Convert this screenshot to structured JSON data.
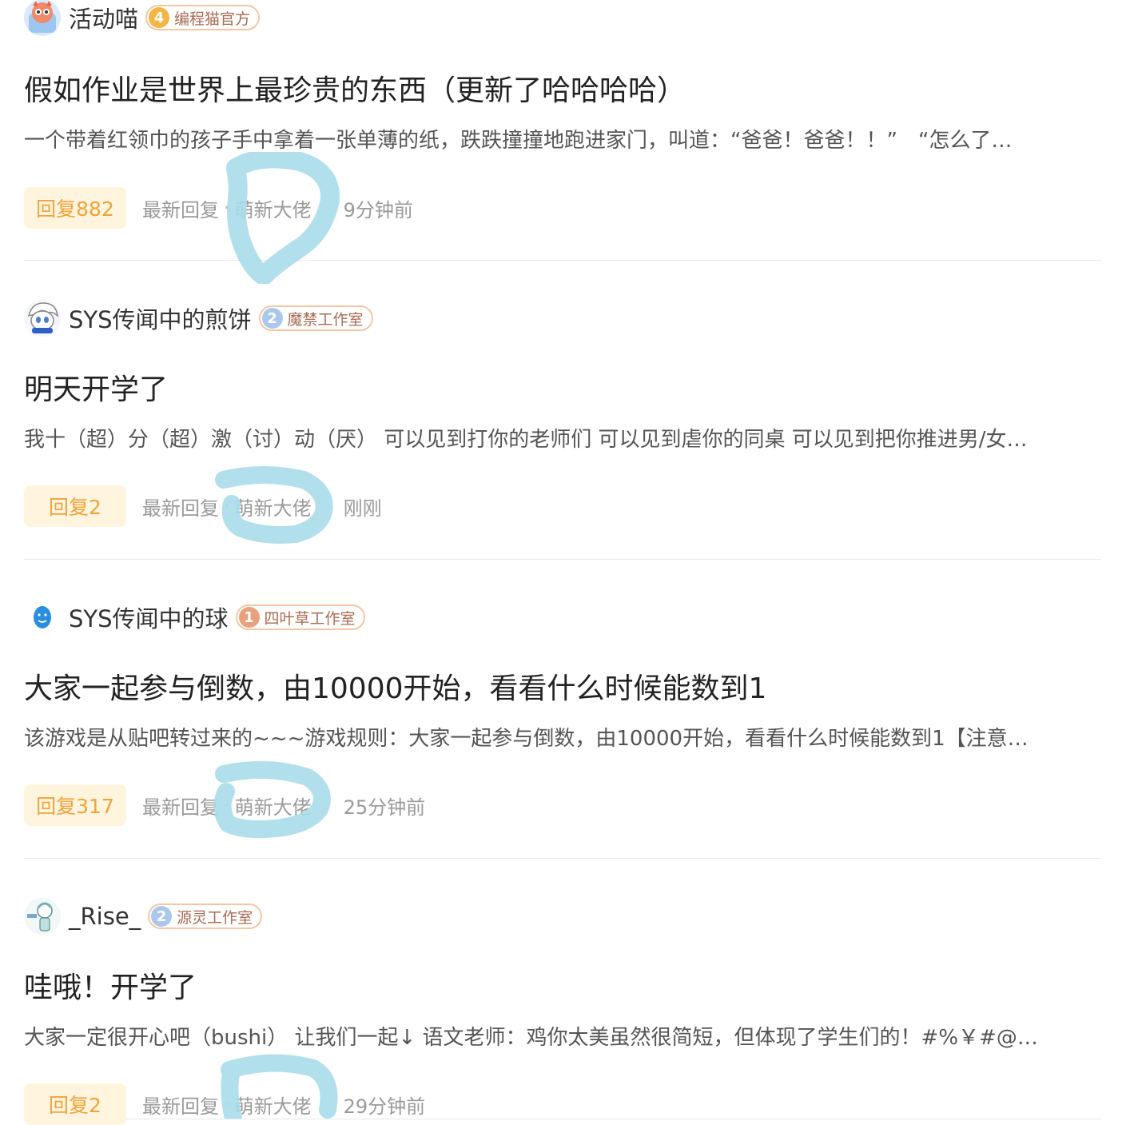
{
  "posts": [
    {
      "author": "活动喵",
      "badge_level": "4",
      "badge_name": "编程猫官方",
      "badge_color": "#f5b544",
      "title": "假如作业是世界上最珍贵的东西（更新了哈哈哈哈）",
      "excerpt": "一个带着红领巾的孩子手中拿着一张单薄的纸，跌跌撞撞地跑进家门，叫道：“爸爸！爸爸！！”　“怎么了…",
      "reply_label": "回复882",
      "latest_label": "最新回复",
      "latest_user": "萌新大佬",
      "time": "9分钟前",
      "avatar_icon": "cat-mascot-icon"
    },
    {
      "author": "SYS传闻中的煎饼",
      "badge_level": "2",
      "badge_name": "魔禁工作室",
      "badge_color": "#a9c8ec",
      "title": "明天开学了",
      "excerpt": "我十（超）分（超）激（讨）动（厌） 可以见到打你的老师们 可以见到虐你的同桌 可以见到把你推进男/女…",
      "reply_label": "回复2",
      "latest_label": "最新回复",
      "latest_user": "萌新大佬",
      "time": "刚刚",
      "avatar_icon": "anime-character-icon"
    },
    {
      "author": "SYS传闻中的球",
      "badge_level": "1",
      "badge_name": "四叶草工作室",
      "badge_color": "#e8a07e",
      "title": "大家一起参与倒数，由10000开始，看看什么时候能数到1",
      "excerpt": "该游戏是从贴吧转过来的~~~游戏规则：大家一起参与倒数，由10000开始，看看什么时候能数到1【注意…",
      "reply_label": "回复317",
      "latest_label": "最新回复",
      "latest_user": "萌新大佬",
      "time": "25分钟前",
      "avatar_icon": "blue-ball-icon"
    },
    {
      "author": "_Rise_",
      "badge_level": "2",
      "badge_name": "源灵工作室",
      "badge_color": "#a9c8ec",
      "title": "哇哦！开学了",
      "excerpt": "大家一定很开心吧（bushi） 让我们一起↓ 语文老师：鸡你太美虽然很简短，但体现了学生们的！#%￥#@…",
      "reply_label": "回复2",
      "latest_label": "最新回复",
      "latest_user": "萌新大佬",
      "time": "29分钟前",
      "avatar_icon": "sketch-character-icon"
    }
  ],
  "colors": {
    "reply_bg": "#fff5df",
    "reply_text": "#f2a33a",
    "scribble": "#a8dcea"
  }
}
